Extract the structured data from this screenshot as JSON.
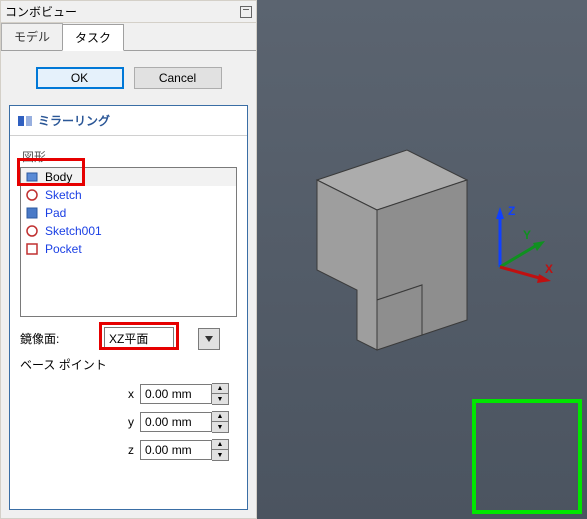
{
  "panel": {
    "title": "コンボビュー",
    "tabs": {
      "model": "モデル",
      "task": "タスク",
      "active": "task"
    },
    "buttons": {
      "ok": "OK",
      "cancel": "Cancel"
    },
    "card": {
      "title": "ミラーリング",
      "shape_label": "図形",
      "items": [
        {
          "label": "Body",
          "link": false,
          "selected": true
        },
        {
          "label": "Sketch",
          "link": true,
          "selected": false
        },
        {
          "label": "Pad",
          "link": true,
          "selected": false
        },
        {
          "label": "Sketch001",
          "link": true,
          "selected": false
        },
        {
          "label": "Pocket",
          "link": true,
          "selected": false
        }
      ],
      "mirror_plane_label": "鏡像面:",
      "mirror_plane_value": "XZ平面",
      "base_point_label": "ベース ポイント",
      "axes": {
        "x": {
          "label": "x",
          "value": "0.00 mm"
        },
        "y": {
          "label": "y",
          "value": "0.00 mm"
        },
        "z": {
          "label": "z",
          "value": "0.00 mm"
        }
      }
    }
  },
  "viewport": {
    "axis_labels": {
      "x": "X",
      "y": "Y",
      "z": "Z"
    }
  },
  "highlights": {
    "body_item": true,
    "mirror_plane": true,
    "nav_axis": true
  }
}
